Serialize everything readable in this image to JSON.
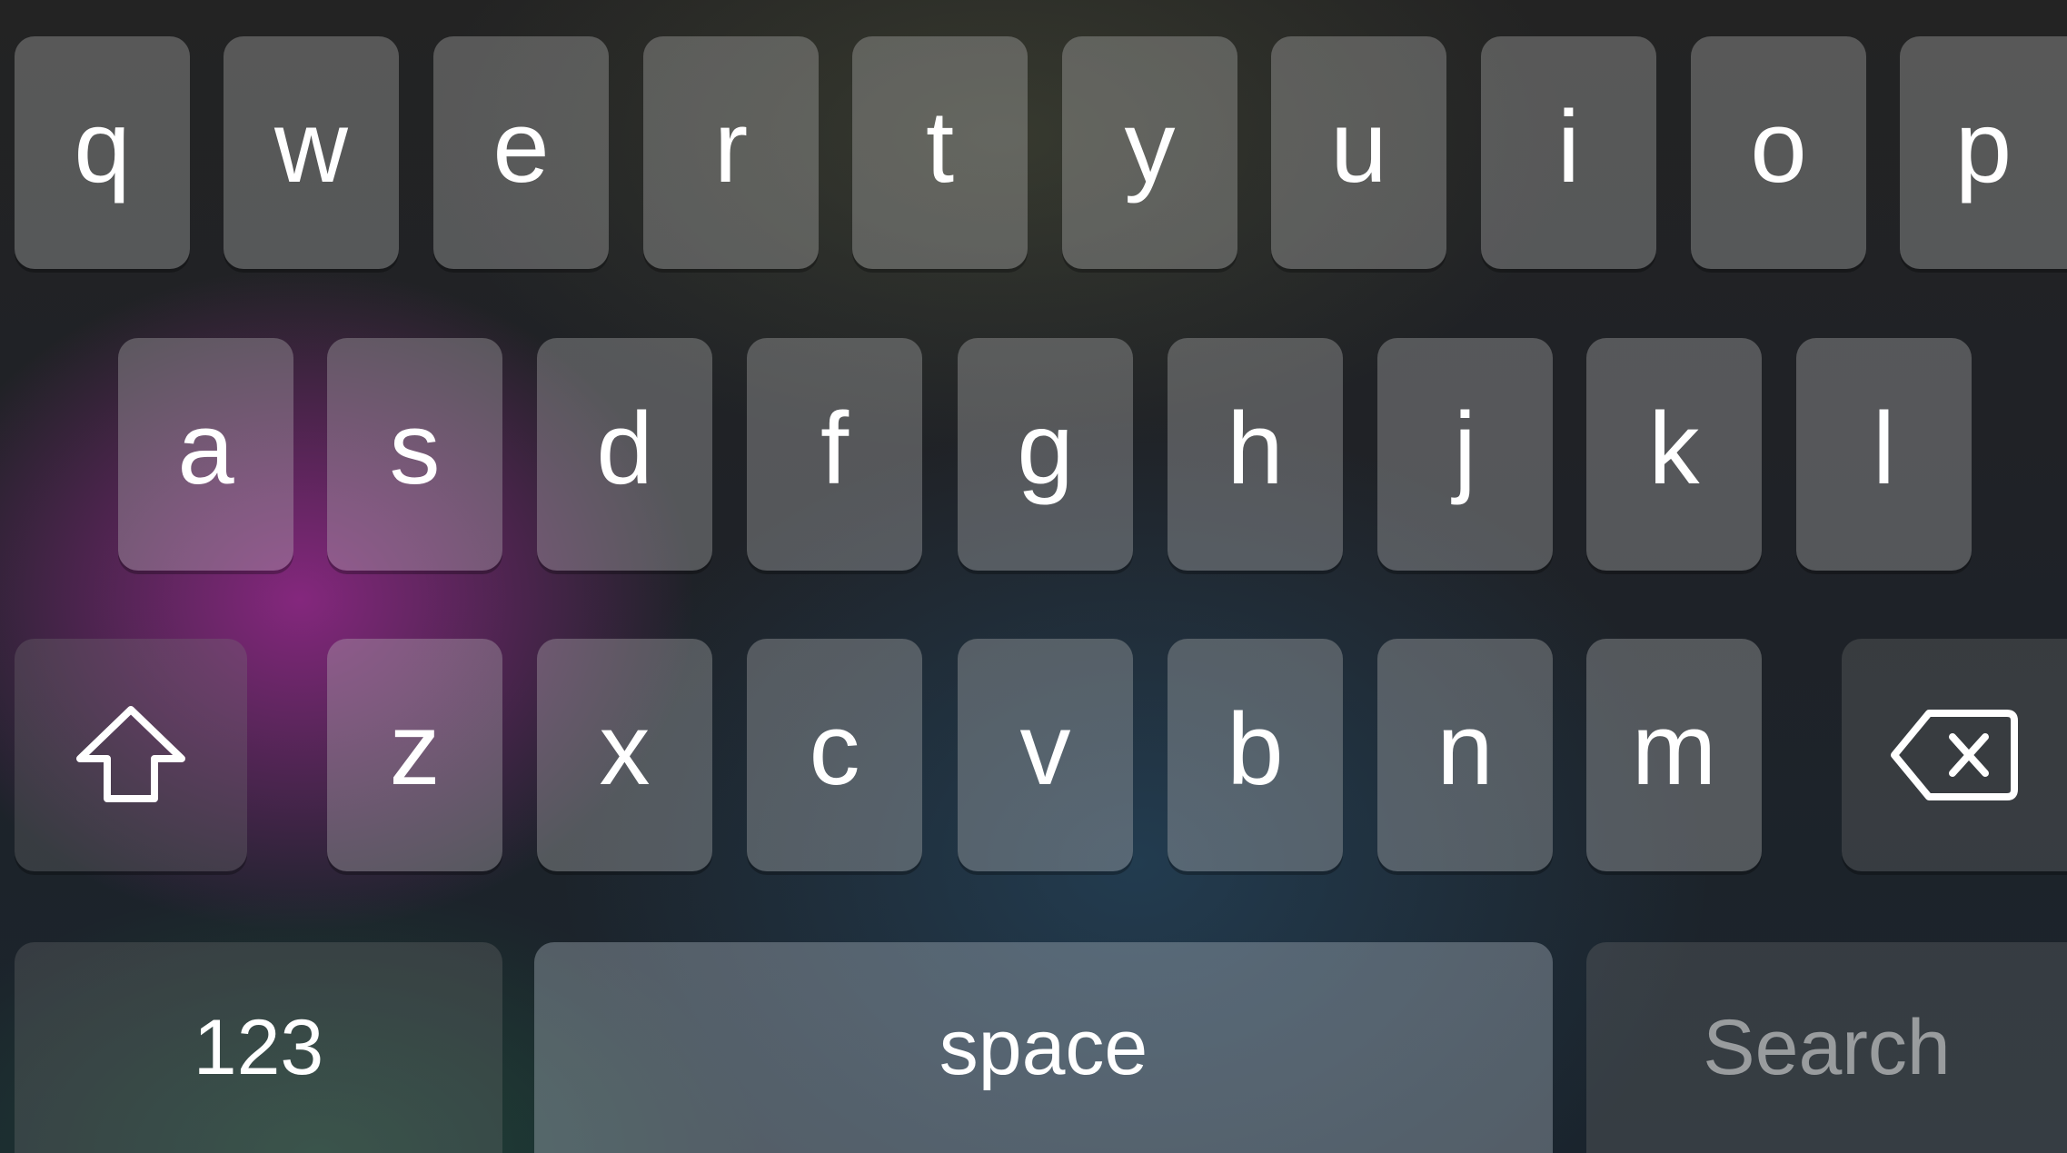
{
  "keyboard": {
    "row1": [
      "q",
      "w",
      "e",
      "r",
      "t",
      "y",
      "u",
      "i",
      "o",
      "p"
    ],
    "row2": [
      "a",
      "s",
      "d",
      "f",
      "g",
      "h",
      "j",
      "k",
      "l"
    ],
    "row3": [
      "z",
      "x",
      "c",
      "v",
      "b",
      "n",
      "m"
    ],
    "shift_icon": "shift-arrow-up-icon",
    "delete_icon": "backspace-delete-icon",
    "numbers_label": "123",
    "space_label": "space",
    "return_label": "Search"
  },
  "colors": {
    "key_text": "#ffffff",
    "search_label_text": "#b8b8b8",
    "accent_glow": "#962c8c"
  }
}
